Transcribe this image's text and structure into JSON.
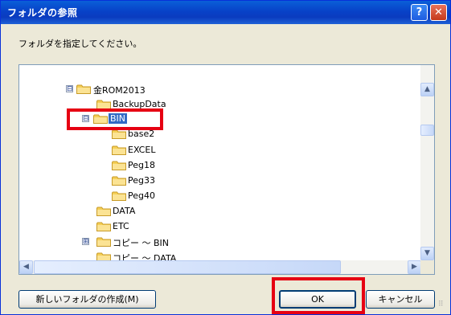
{
  "dialog": {
    "title": "フォルダの参照",
    "help_glyph": "?",
    "close_glyph": "✕",
    "prompt": "フォルダを指定してください。"
  },
  "tree": {
    "nodes": [
      {
        "label": "金ROM2013",
        "expander": "⊟"
      },
      {
        "label": "BackupData"
      },
      {
        "label": "BIN",
        "expander": "⊟",
        "selected": true
      },
      {
        "label": "base2"
      },
      {
        "label": "EXCEL"
      },
      {
        "label": "Peg18"
      },
      {
        "label": "Peg33"
      },
      {
        "label": "Peg40"
      },
      {
        "label": "DATA"
      },
      {
        "label": "ETC"
      },
      {
        "label": "コピー ～ BIN",
        "expander": "⊞"
      },
      {
        "label": "コピー ～ DATA"
      }
    ]
  },
  "scrollbars": {
    "up": "▲",
    "down": "▼",
    "left": "◀",
    "right": "▶"
  },
  "buttons": {
    "new_folder": "新しいフォルダの作成(M)",
    "ok": "OK",
    "cancel": "キャンセル"
  },
  "colors": {
    "titlebar": "#0a3bbf",
    "selection": "#316ac5",
    "highlight": "#e60012",
    "folder": "#f5cf56"
  }
}
